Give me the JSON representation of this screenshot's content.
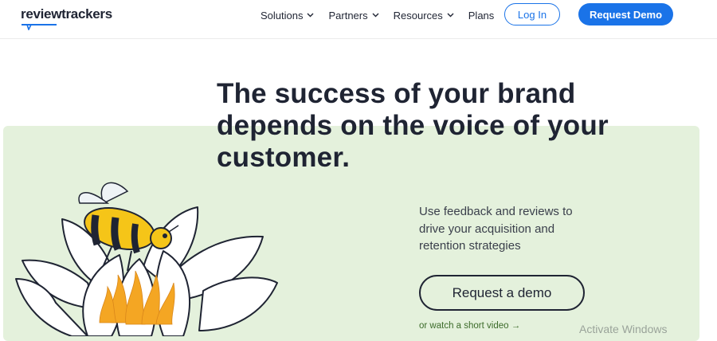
{
  "header": {
    "logo_text": "reviewtrackers",
    "nav": [
      {
        "label": "Solutions",
        "has_dropdown": true
      },
      {
        "label": "Partners",
        "has_dropdown": true
      },
      {
        "label": "Resources",
        "has_dropdown": true
      },
      {
        "label": "Plans",
        "has_dropdown": false
      }
    ],
    "login_label": "Log In",
    "demo_label": "Request Demo"
  },
  "hero": {
    "headline_line1": "The success of your brand",
    "headline_line2": "depends on the voice of your",
    "headline_line3": "customer.",
    "sub_line1": "Use feedback and reviews to",
    "sub_line2": "drive your acquisition and",
    "sub_line3": "retention strategies",
    "cta_label": "Request a demo",
    "video_link": "or watch a short video →"
  },
  "os": {
    "watermark": "Activate Windows"
  },
  "colors": {
    "accent": "#1a73e8",
    "panel": "#e4f1dc",
    "text": "#1f2433",
    "link_green": "#3c6b2a",
    "bee_yellow": "#f5c518",
    "flame_orange": "#f4a623"
  }
}
